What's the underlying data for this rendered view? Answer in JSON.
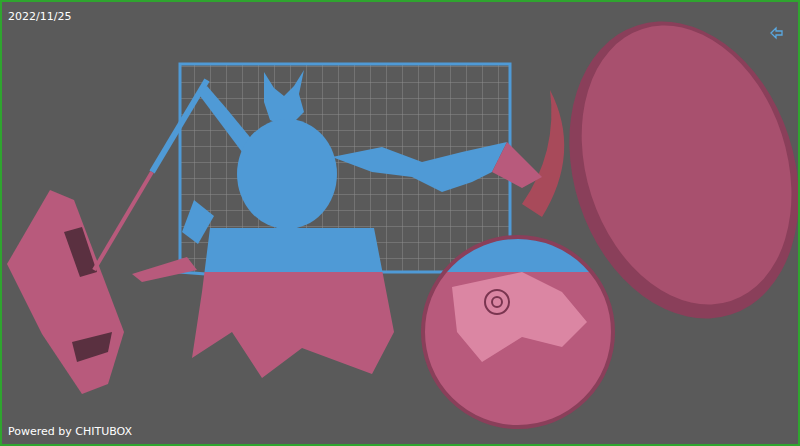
{
  "viewport": {
    "date": "2022/11/25",
    "brand": "Powered by CHITUBOX"
  }
}
